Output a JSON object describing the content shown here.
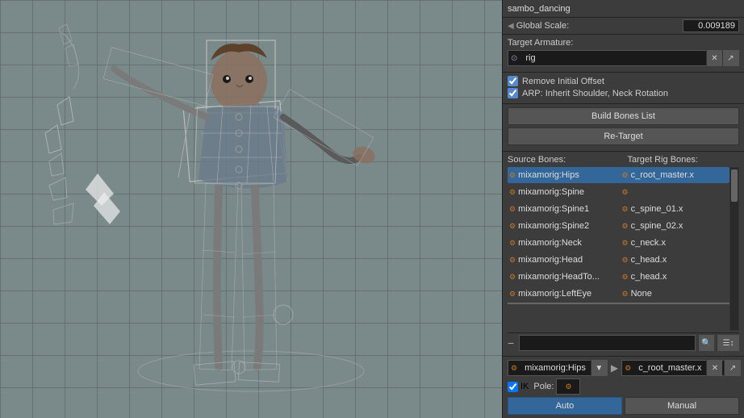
{
  "viewport": {
    "background_color": "#7a8a8a"
  },
  "panel": {
    "top_label": "sambo_dancing",
    "global_scale_label": "Global Scale:",
    "global_scale_value": "0.009189",
    "target_armature_label": "Target Armature:",
    "target_armature_value": "rig",
    "remove_initial_offset_label": "Remove Initial Offset",
    "arp_inherit_label": "ARP: Inherit Shoulder, Neck Rotation",
    "build_bones_btn": "Build Bones List",
    "retarget_btn": "Re-Target",
    "source_bones_label": "Source Bones:",
    "target_rig_bones_label": "Target Rig Bones:",
    "bones": [
      {
        "source": "mixamorig:Hips",
        "target": "c_root_master.x",
        "selected": true
      },
      {
        "source": "mixamorig:Spine",
        "target": "",
        "selected": false
      },
      {
        "source": "mixamorig:Spine1",
        "target": "c_spine_01.x",
        "selected": false
      },
      {
        "source": "mixamorig:Spine2",
        "target": "c_spine_02.x",
        "selected": false
      },
      {
        "source": "mixamorig:Neck",
        "target": "c_neck.x",
        "selected": false
      },
      {
        "source": "mixamorig:Head",
        "target": "c_head.x",
        "selected": false
      },
      {
        "source": "mixamorig:HeadTo...",
        "target": "c_head.x",
        "selected": false
      },
      {
        "source": "mixamorig:LeftEye",
        "target": "None",
        "selected": false
      }
    ],
    "retarget_source": "mixamorig:Hips",
    "retarget_target": "c_root_master.x",
    "ik_label": "IK",
    "pole_label": "Pole:",
    "auto_btn": "Auto",
    "manual_btn": "Manual"
  }
}
